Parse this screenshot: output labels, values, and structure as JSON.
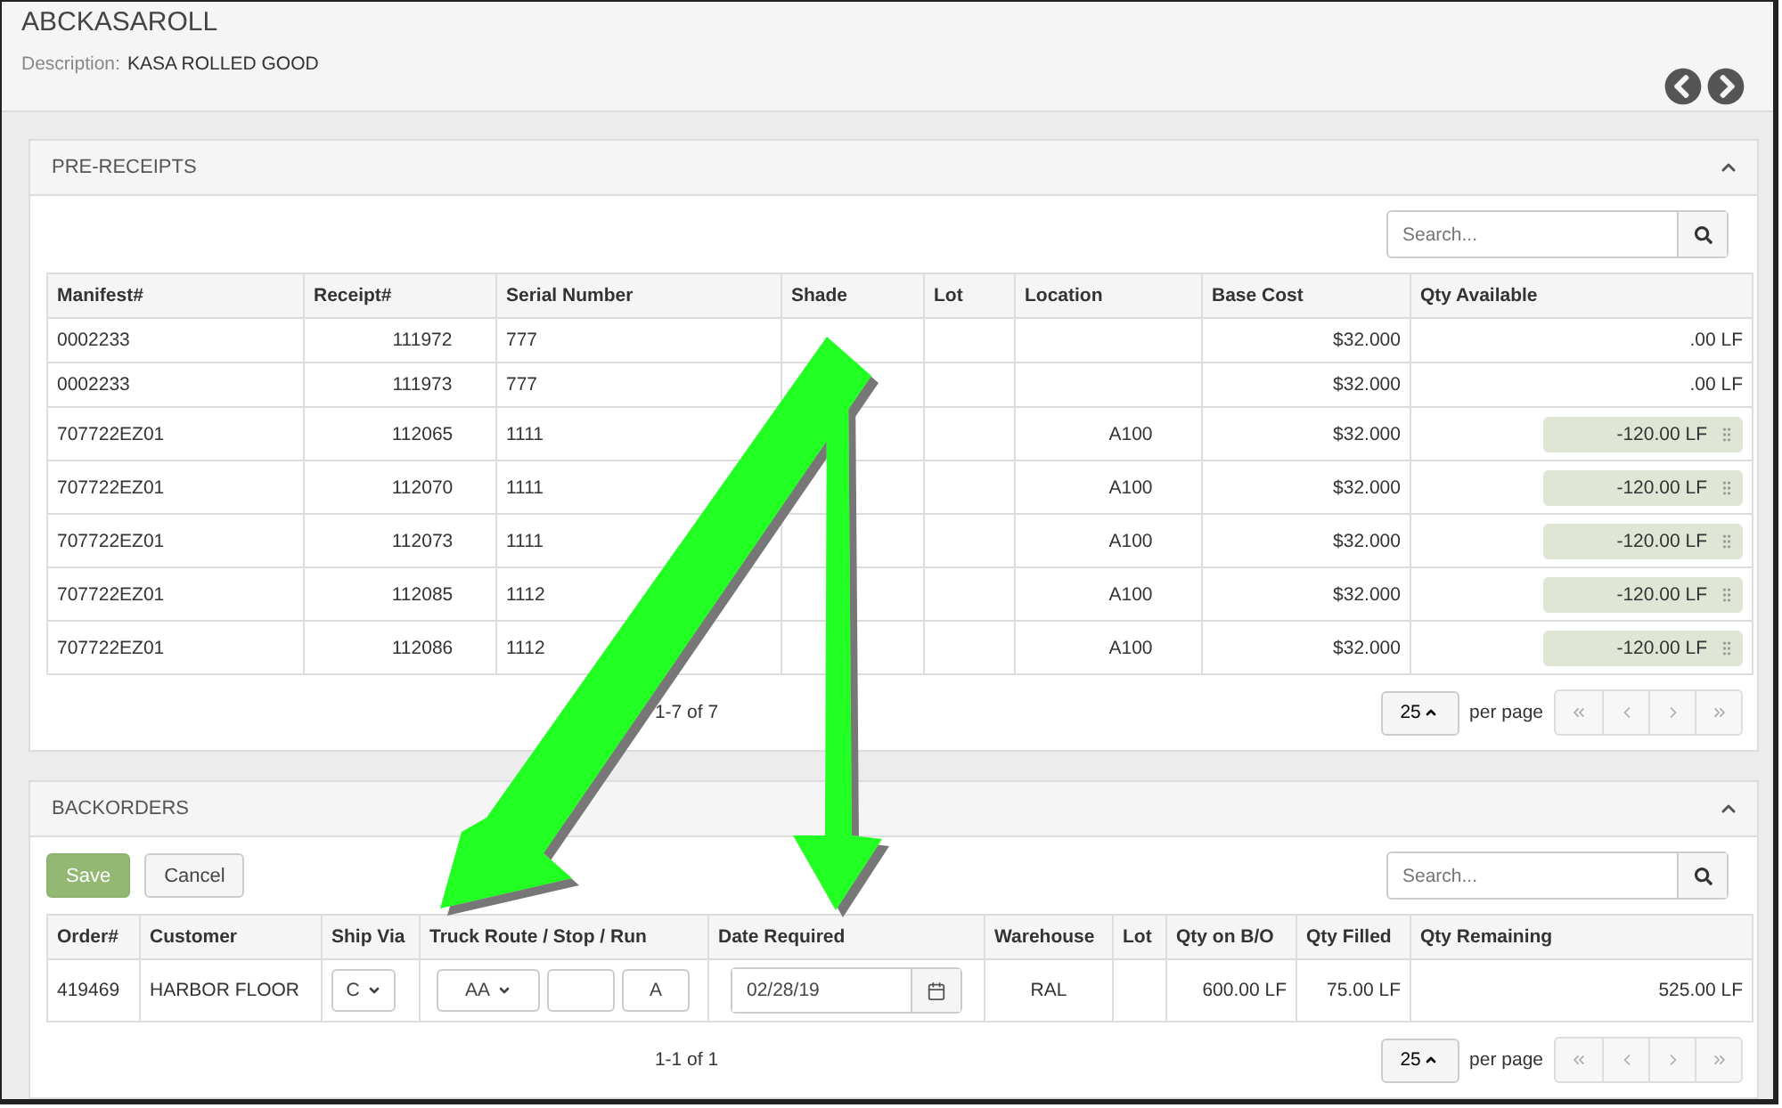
{
  "item": {
    "title": "ABCKASAROLL",
    "description_label": "Description:",
    "description": "KASA ROLLED GOOD"
  },
  "pre_receipts": {
    "title": "PRE-RECEIPTS",
    "expanded": true,
    "search": {
      "placeholder": "Search..."
    },
    "columns": [
      {
        "label": "Manifest#"
      },
      {
        "label": "Receipt#"
      },
      {
        "label": "Serial Number"
      },
      {
        "label": "Shade"
      },
      {
        "label": "Lot"
      },
      {
        "label": "Location"
      },
      {
        "label": "Base Cost"
      },
      {
        "label": "Qty Available"
      }
    ],
    "rows": [
      {
        "cells": [
          "0002233",
          "111972",
          "777",
          "",
          "",
          "",
          "$32.000"
        ],
        "qty": {
          "kind": "plain",
          "text": ".00 LF"
        }
      },
      {
        "cells": [
          "0002233",
          "111973",
          "777",
          "",
          "",
          "",
          "$32.000"
        ],
        "qty": {
          "kind": "plain",
          "text": ".00 LF"
        }
      },
      {
        "cells": [
          "707722EZ01",
          "112065",
          "1111",
          "",
          "",
          "A100",
          "$32.000"
        ],
        "qty": {
          "kind": "pill",
          "text": "-120.00 LF"
        }
      },
      {
        "cells": [
          "707722EZ01",
          "112070",
          "1111",
          "",
          "",
          "A100",
          "$32.000"
        ],
        "qty": {
          "kind": "pill",
          "text": "-120.00 LF"
        }
      },
      {
        "cells": [
          "707722EZ01",
          "112073",
          "1111",
          "",
          "",
          "A100",
          "$32.000"
        ],
        "qty": {
          "kind": "pill",
          "text": "-120.00 LF"
        }
      },
      {
        "cells": [
          "707722EZ01",
          "112085",
          "1112",
          "",
          "",
          "A100",
          "$32.000"
        ],
        "qty": {
          "kind": "pill",
          "text": "-120.00 LF"
        }
      },
      {
        "cells": [
          "707722EZ01",
          "112086",
          "1112",
          "",
          "",
          "A100",
          "$32.000"
        ],
        "qty": {
          "kind": "pill",
          "text": "-120.00 LF"
        }
      }
    ],
    "range": "1-7 of 7",
    "page_size": "25",
    "per_page": "per page"
  },
  "backorders": {
    "title": "BACKORDERS",
    "expanded": true,
    "save": "Save",
    "cancel": "Cancel",
    "search": {
      "placeholder": "Search..."
    },
    "columns": [
      {
        "label": "Order#"
      },
      {
        "label": "Customer"
      },
      {
        "label": "Ship Via"
      },
      {
        "label": "Truck Route / Stop / Run"
      },
      {
        "label": "Date Required"
      },
      {
        "label": "Warehouse"
      },
      {
        "label": "Lot"
      },
      {
        "label": "Qty on B/O"
      },
      {
        "label": "Qty Filled"
      },
      {
        "label": "Qty Remaining"
      }
    ],
    "rows": [
      {
        "order": "419469",
        "customer": "HARBOR FLOOR",
        "ship_via": "C",
        "route": "AA",
        "stop": "",
        "run": "A",
        "date": "02/28/19",
        "warehouse": "RAL",
        "lot": "",
        "qty_bo": "600.00 LF",
        "qty_filled": "75.00 LF",
        "qty_remaining": "525.00 LF"
      }
    ],
    "range": "1-1 of 1",
    "page_size": "25",
    "per_page": "per page"
  }
}
